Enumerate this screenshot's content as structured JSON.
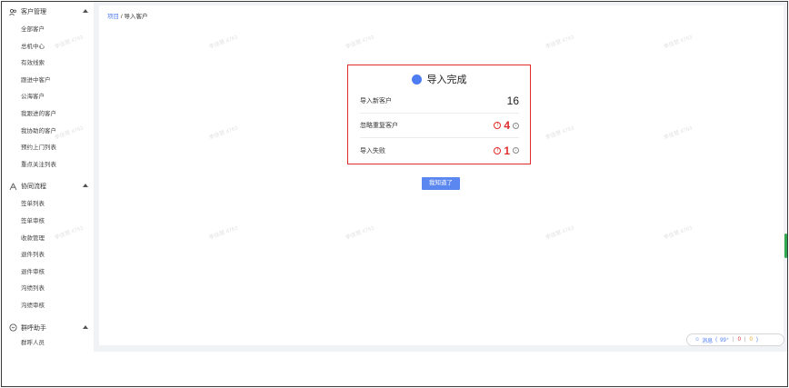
{
  "sidebar": {
    "groups": [
      {
        "title": "客户管理",
        "icon": "users-icon",
        "items": [
          "全部客户",
          "总机中心",
          "有效线索",
          "跟进中客户",
          "公海客户",
          "我跟进的客户",
          "我协助的客户",
          "预约上门列表",
          "重点关注列表"
        ]
      },
      {
        "title": "协同流程",
        "icon": "flow-icon",
        "items": [
          "签单列表",
          "签单审核",
          "收款管理",
          "退件列表",
          "退件审核",
          "沟绩列表",
          "沟绩审核"
        ]
      },
      {
        "title": "群呼助手",
        "icon": "chat-icon",
        "items": [
          "群呼人员"
        ]
      }
    ]
  },
  "breadcrumb": {
    "link": "项目",
    "separator": "/",
    "current": "导入客户"
  },
  "dialog": {
    "title": "导入完成",
    "accent": "#4e7cf2",
    "rows": [
      {
        "label": "导入新客户",
        "value": "16"
      },
      {
        "label": "忽略重复客户",
        "value": "4"
      },
      {
        "label": "导入失败",
        "value": "1"
      }
    ]
  },
  "ok_button": "我知道了",
  "messages": {
    "label": "消息",
    "open": "(",
    "count1": "99⁺",
    "count2": "0",
    "count3": "0",
    "close": ")"
  },
  "watermark": "李佳慧 4763"
}
